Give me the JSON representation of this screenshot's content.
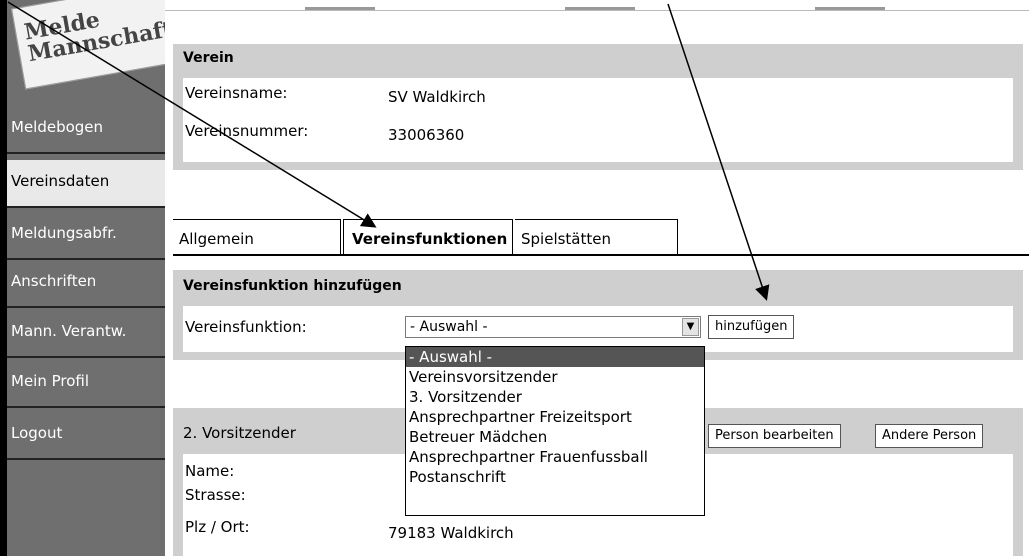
{
  "logo": {
    "text": "Melde\nMannschaft"
  },
  "sidebar": {
    "items": [
      {
        "label": "Meldebogen"
      },
      {
        "label": "Vereinsdaten"
      },
      {
        "label": "Meldungsabfr."
      },
      {
        "label": "Anschriften"
      },
      {
        "label": "Mann. Verantw."
      },
      {
        "label": "Mein Profil"
      },
      {
        "label": "Logout"
      }
    ]
  },
  "verein": {
    "title": "Verein",
    "name_label": "Vereinsname:",
    "name_value": "SV Waldkirch",
    "number_label": "Vereinsnummer:",
    "number_value": "33006360"
  },
  "tabs": [
    {
      "label": "Allgemein"
    },
    {
      "label": "Vereinsfunktionen"
    },
    {
      "label": "Spielstätten"
    }
  ],
  "add_function": {
    "title": "Vereinsfunktion hinzufügen",
    "field_label": "Vereinsfunktion:",
    "selected": "- Auswahl -",
    "button": "hinzufügen",
    "options": [
      "- Auswahl -",
      "Vereinsvorsitzender",
      "3. Vorsitzender",
      "Ansprechpartner Freizeitsport",
      "Betreuer Mädchen",
      "Ansprechpartner Frauenfussball",
      "Postanschrift"
    ]
  },
  "vorsitzender": {
    "title": "2. Vorsitzender",
    "edit_button": "Person bearbeiten",
    "other_button": "Andere Person",
    "name_label": "Name:",
    "street_label": "Strasse:",
    "city_label": "Plz / Ort:",
    "city_value": "79183  Waldkirch"
  },
  "colors": {
    "sidebar": "#6f6f6f",
    "panel": "#cfcfcf",
    "selected_option": "#555555"
  }
}
